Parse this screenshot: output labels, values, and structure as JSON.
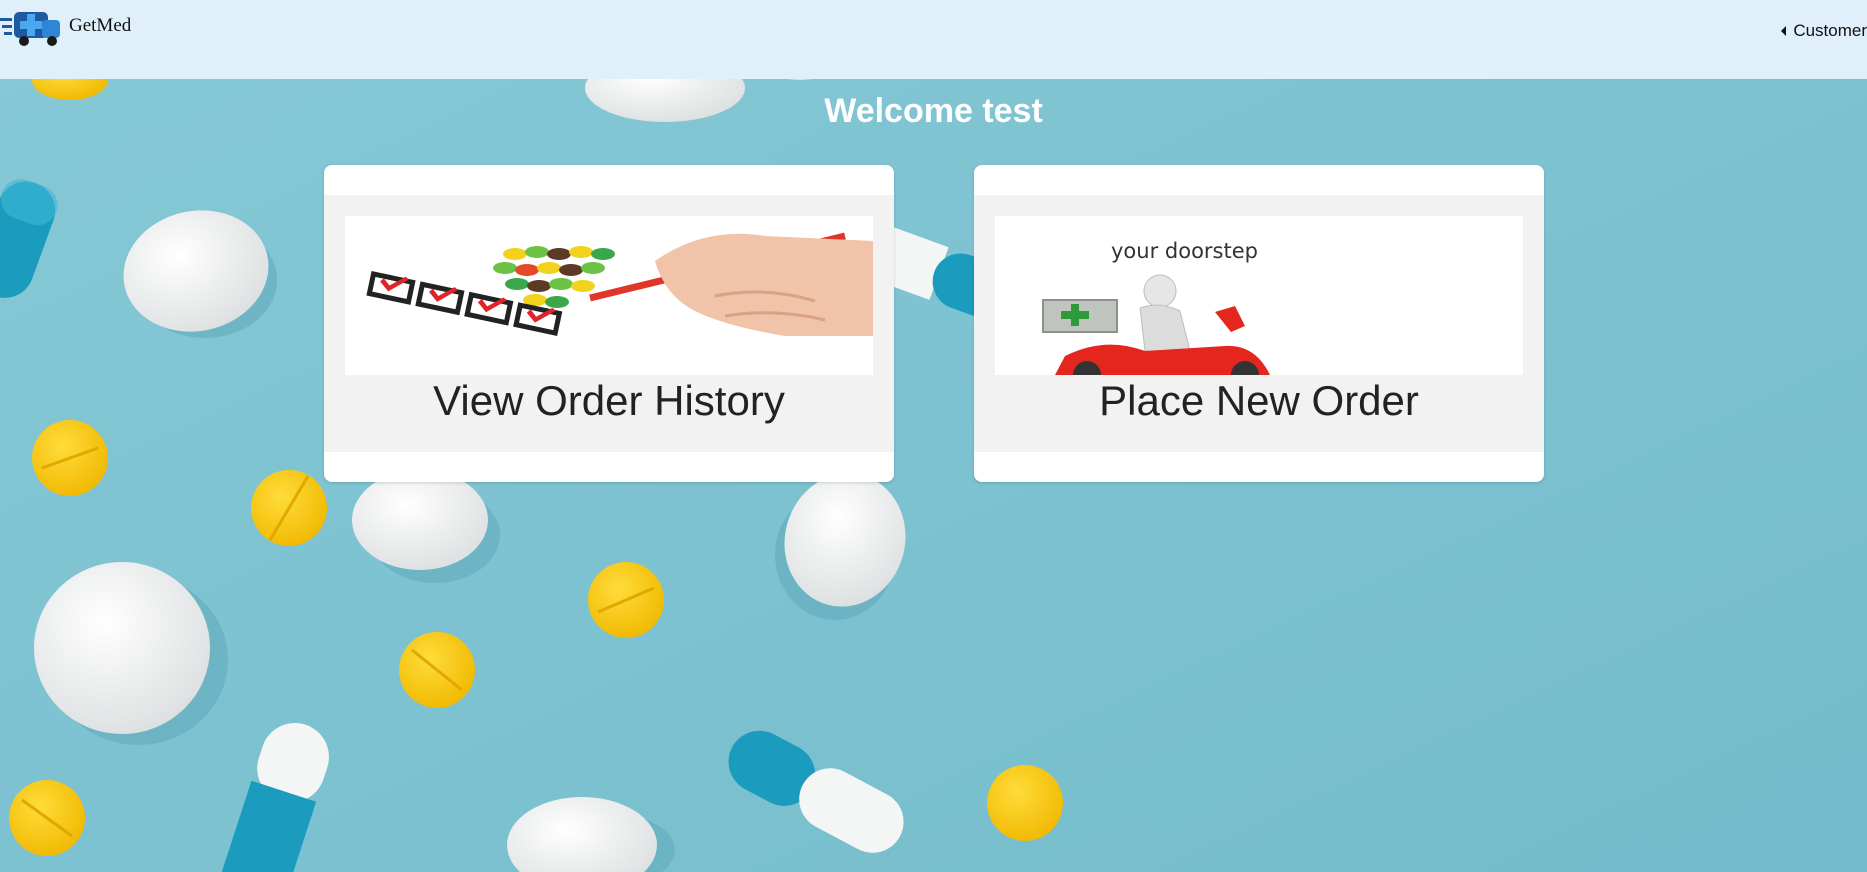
{
  "navbar": {
    "brand_name": "GetMed",
    "user_menu_label": "Customer"
  },
  "main": {
    "welcome": "Welcome test"
  },
  "cards": [
    {
      "label": "View Order History",
      "image": "order-history-checklist"
    },
    {
      "label": "Place New Order",
      "image_text": "your doorstep"
    }
  ],
  "colors": {
    "navbar_bg": "#dff0fb",
    "page_bg": "#7fc4d2",
    "card_bg": "#ffffff",
    "card_inner_bg": "#f2f2f2",
    "pill_yellow": "#f7c51c",
    "pill_blue": "#1b9bbd"
  }
}
